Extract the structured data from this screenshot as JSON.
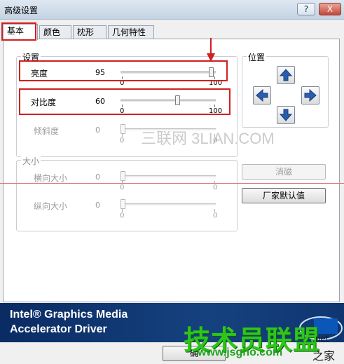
{
  "window": {
    "title": "高级设置",
    "help_label": "?",
    "close_label": "X"
  },
  "tabs": [
    {
      "label": "基本"
    },
    {
      "label": "颜色"
    },
    {
      "label": "枕形"
    },
    {
      "label": "几何特性"
    }
  ],
  "settings_group": {
    "title": "设置",
    "rows": [
      {
        "label": "亮度",
        "value": "95",
        "min": "0",
        "max": "100",
        "level": 0.95
      },
      {
        "label": "对比度",
        "value": "60",
        "min": "0",
        "max": "100",
        "level": 0.6
      },
      {
        "label": "倾斜度",
        "value": "0",
        "min": "0",
        "max": "0",
        "level": 0
      }
    ]
  },
  "size_group": {
    "title": "大小",
    "rows": [
      {
        "label": "横向大小",
        "value": "0",
        "min": "0",
        "max": "0"
      },
      {
        "label": "纵向大小",
        "value": "0",
        "min": "0",
        "max": "0"
      }
    ]
  },
  "position_group": {
    "title": "位置"
  },
  "buttons": {
    "cancel": "消磁",
    "defaults": "厂家默认值",
    "ok_partial": "确"
  },
  "banner": {
    "line1": "Intel® Graphics Media",
    "line2": "Accelerator Driver"
  },
  "watermarks": {
    "center": "三联网 3LIAN.COM",
    "green": "技术员联盟",
    "url": "www.jsgho.com",
    "net": ".net",
    "corner": "之家"
  },
  "colors": {
    "accent_red": "#d21f1f",
    "banner_blue": "#15427f",
    "arrow_blue": "#2a5db0"
  }
}
